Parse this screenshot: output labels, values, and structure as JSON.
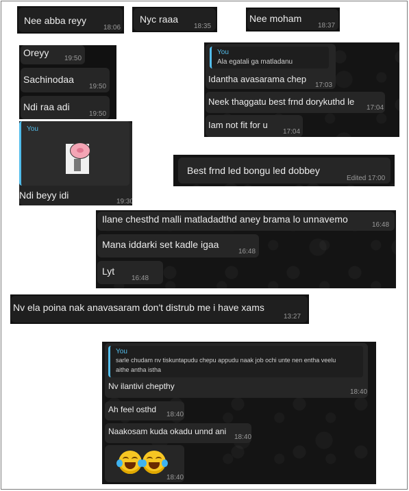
{
  "messages": {
    "m1": {
      "text": "Nee abba reyy",
      "time": "18:06"
    },
    "m2": {
      "text": "Nyc raaa",
      "time": "18:35"
    },
    "m3": {
      "text": "Nee moham",
      "time": "18:37"
    },
    "m4": {
      "text": "Oreyy",
      "time": "19:50"
    },
    "m5": {
      "text": "Sachinodaa",
      "time": "19:50"
    },
    "m6": {
      "text": "Ndi raa adi",
      "time": "19:50"
    },
    "m7": {
      "quote_name": "You",
      "text": "Ndi beyy idi",
      "time": "19:30"
    },
    "m8": {
      "quote_name": "You",
      "quote_text": "Ala egatali ga matladanu",
      "text": "Idantha avasarama chep",
      "time": "17:03"
    },
    "m9": {
      "text": "Neek thaggatu best frnd dorykuthd le",
      "time": "17:04"
    },
    "m10": {
      "text": "Iam not fit for u",
      "time": "17:04"
    },
    "m11": {
      "text": "Best frnd led bongu led dobbey",
      "time": "Edited 17:00"
    },
    "m12": {
      "text": "Ilane chesthd malli matladadthd aney brama lo unnavemo",
      "time": "16:48"
    },
    "m13": {
      "text": "Mana iddarki set kadle igaa",
      "time": "16:48"
    },
    "m14": {
      "text": "Lyt",
      "time": "16:48"
    },
    "m15": {
      "text": "Nv ela poina nak anavasaram don't distrub me i have xams",
      "time": "13:27"
    },
    "m16": {
      "quote_name": "You",
      "quote_line1": "sarle chudam nv tiskuntapudu chepu appudu naak job ochi unte nen entha veelu",
      "quote_line2": "aithe antha istha",
      "text": "Nv ilantivi chepthy",
      "time": "18:40"
    },
    "m17": {
      "text": "Ah feel osthd",
      "time": "18:40"
    },
    "m18": {
      "text": "Naakosam kuda okadu unnd ani",
      "time": "18:40"
    },
    "m19": {
      "emoji": "rolling-on-floor-laughing x2",
      "time": "18:40"
    }
  },
  "colors": {
    "panel": "#111111",
    "bubble": "#262626",
    "accent": "#53bdeb"
  }
}
